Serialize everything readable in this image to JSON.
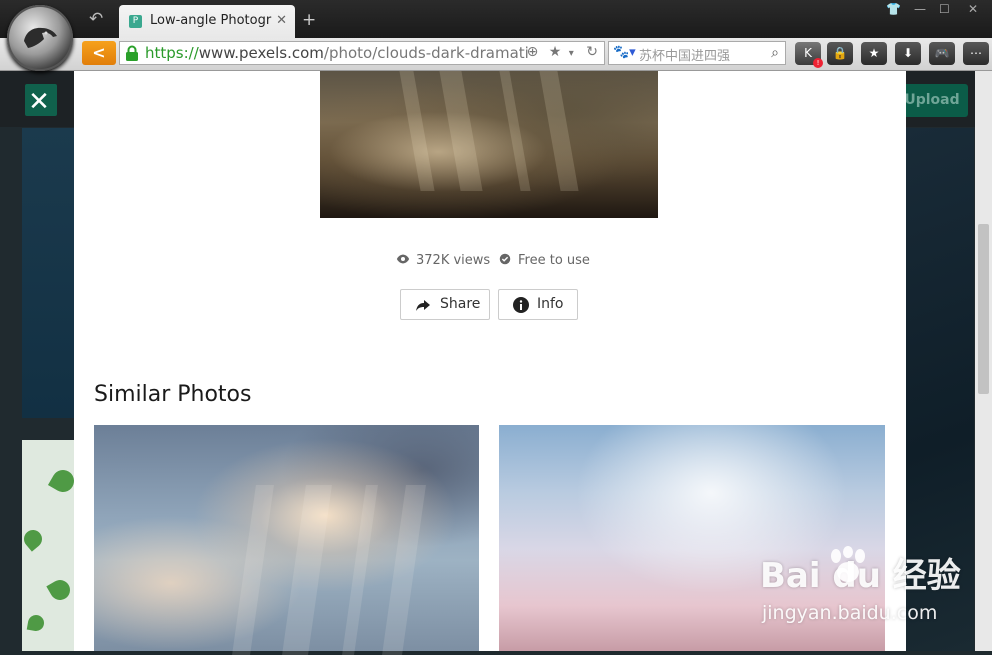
{
  "browser": {
    "tab": {
      "title": "Low-angle Photogr",
      "favicon": "P"
    },
    "url": {
      "scheme": "https://",
      "host": "www.pexels.com",
      "path": "/photo/clouds-dark-dramati"
    },
    "search": {
      "engine_icon": "baidu-paw-icon",
      "placeholder": "苏杯中国进四强"
    },
    "toolbar_buttons": [
      "K",
      "lock",
      "star",
      "download",
      "gamepad",
      "more"
    ]
  },
  "header": {
    "upload_label": "Upload"
  },
  "photo": {
    "views": "372K views",
    "license": "Free to use",
    "share_label": "Share",
    "info_label": "Info"
  },
  "similar": {
    "title": "Similar Photos"
  },
  "watermark": {
    "brand": "Bai du 经验",
    "sub": "jingyan.baidu.com"
  },
  "colors": {
    "accent_green": "#05a081",
    "nav_orange": "#f29a16",
    "header_dark": "#1d2225"
  }
}
